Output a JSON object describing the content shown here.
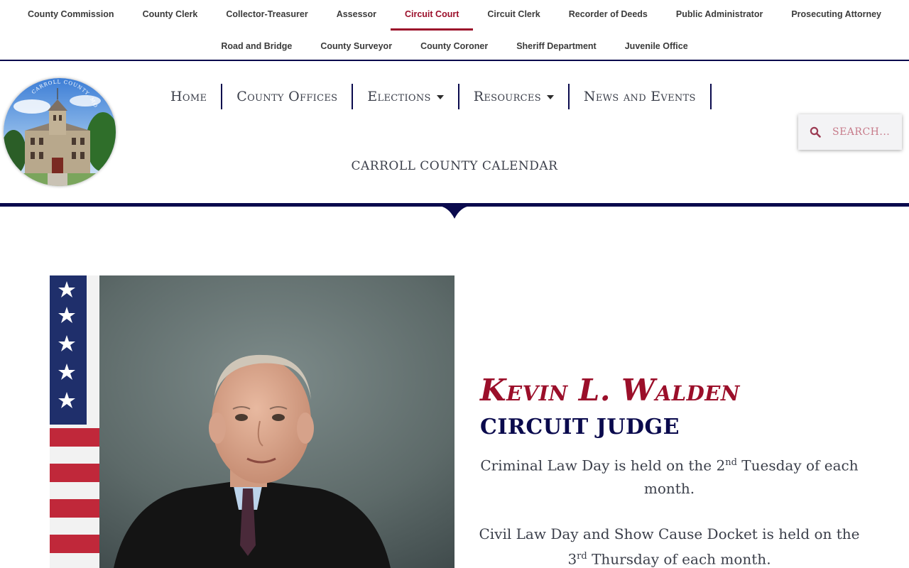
{
  "topnav": {
    "row1": [
      "County Commission",
      "County Clerk",
      "Collector-Treasurer",
      "Assessor",
      "Circuit Court",
      "Circuit Clerk",
      "Recorder of Deeds",
      "Public Administrator",
      "Prosecuting Attorney"
    ],
    "row2": [
      "Road and Bridge",
      "County Surveyor",
      "County Coroner",
      "Sheriff Department",
      "Juvenile Office"
    ],
    "active": "Circuit Court"
  },
  "logo": {
    "alt": "Carroll County logo",
    "text": "CARROLL COUNTY, MO"
  },
  "mainnav": {
    "items": [
      {
        "label": "Home",
        "dropdown": false
      },
      {
        "label": "County Offices",
        "dropdown": false
      },
      {
        "label": "Elections",
        "dropdown": true
      },
      {
        "label": "Resources",
        "dropdown": true
      },
      {
        "label": "News and Events",
        "dropdown": false
      }
    ],
    "calendar": "CARROLL COUNTY CALENDAR"
  },
  "search": {
    "placeholder": "SEARCH..."
  },
  "content": {
    "name": "Kevin L. Walden",
    "title": "CIRCUIT JUDGE",
    "para1_a": "Criminal Law Day is held on the 2",
    "para1_sup": "nd",
    "para1_b": " Tuesday of each month.",
    "para2_a": "Civil Law Day and Show Cause Docket is held on the",
    "para2_b": "3",
    "para2_sup": "rd",
    "para2_c": " Thursday of each month."
  },
  "colors": {
    "accent_red": "#9b0f2a",
    "navy": "#0a0a4d",
    "text": "#3b3f4a"
  }
}
